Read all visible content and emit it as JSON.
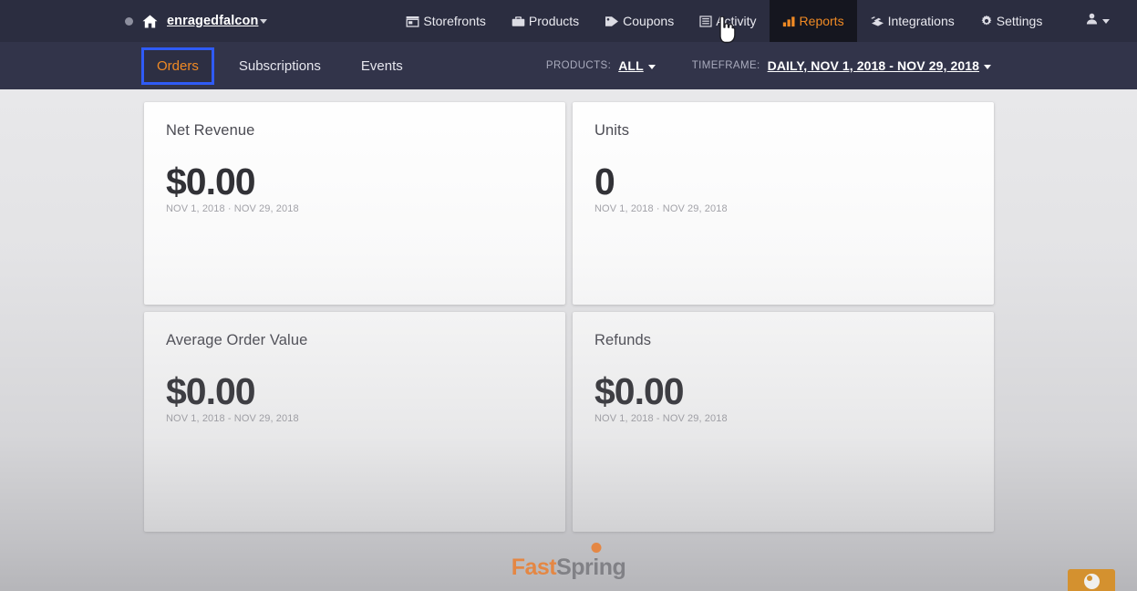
{
  "topbar": {
    "status_dot": "status-dot",
    "home_icon": "home-icon",
    "brand_name": "enragedfalcon",
    "nav": [
      {
        "label": "Storefronts",
        "icon": "storefront-icon",
        "active": false
      },
      {
        "label": "Products",
        "icon": "briefcase-icon",
        "active": false
      },
      {
        "label": "Coupons",
        "icon": "tag-icon",
        "active": false
      },
      {
        "label": "Activity",
        "icon": "list-icon",
        "active": false
      },
      {
        "label": "Reports",
        "icon": "bar-chart-icon",
        "active": true
      },
      {
        "label": "Integrations",
        "icon": "plug-icon",
        "active": false
      },
      {
        "label": "Settings",
        "icon": "gear-icon",
        "active": false
      }
    ],
    "user_icon": "user-icon"
  },
  "subbar": {
    "tabs": [
      {
        "label": "Orders",
        "active": true
      },
      {
        "label": "Subscriptions",
        "active": false
      },
      {
        "label": "Events",
        "active": false
      }
    ],
    "filters": {
      "products_label": "PRODUCTS:",
      "products_value": "ALL",
      "timeframe_label": "TIMEFRAME:",
      "timeframe_value": "DAILY, NOV 1, 2018 - NOV 29, 2018"
    }
  },
  "cards": [
    {
      "title": "Net Revenue",
      "value": "$0.00",
      "range": "NOV 1, 2018 · NOV 29, 2018"
    },
    {
      "title": "Units",
      "value": "0",
      "range": "NOV 1, 2018 · NOV 29, 2018"
    },
    {
      "title": "Average Order Value",
      "value": "$0.00",
      "range": "NOV 1, 2018 - NOV 29, 2018"
    },
    {
      "title": "Refunds",
      "value": "$0.00",
      "range": "NOV 1, 2018 - NOV 29, 2018"
    }
  ],
  "footer": {
    "logo_fast": "Fast",
    "logo_spr": "Spr",
    "logo_i": "i",
    "logo_ng": "ng"
  },
  "chat": {
    "icon": "chat-avatar-icon"
  },
  "colors": {
    "topbar_bg": "#2b2d40",
    "subbar_bg": "#32344a",
    "accent_orange": "#f08a24",
    "focus_blue": "#2f5bf6",
    "page_bg": "#e8e8ea",
    "card_bg": "#ffffff"
  }
}
